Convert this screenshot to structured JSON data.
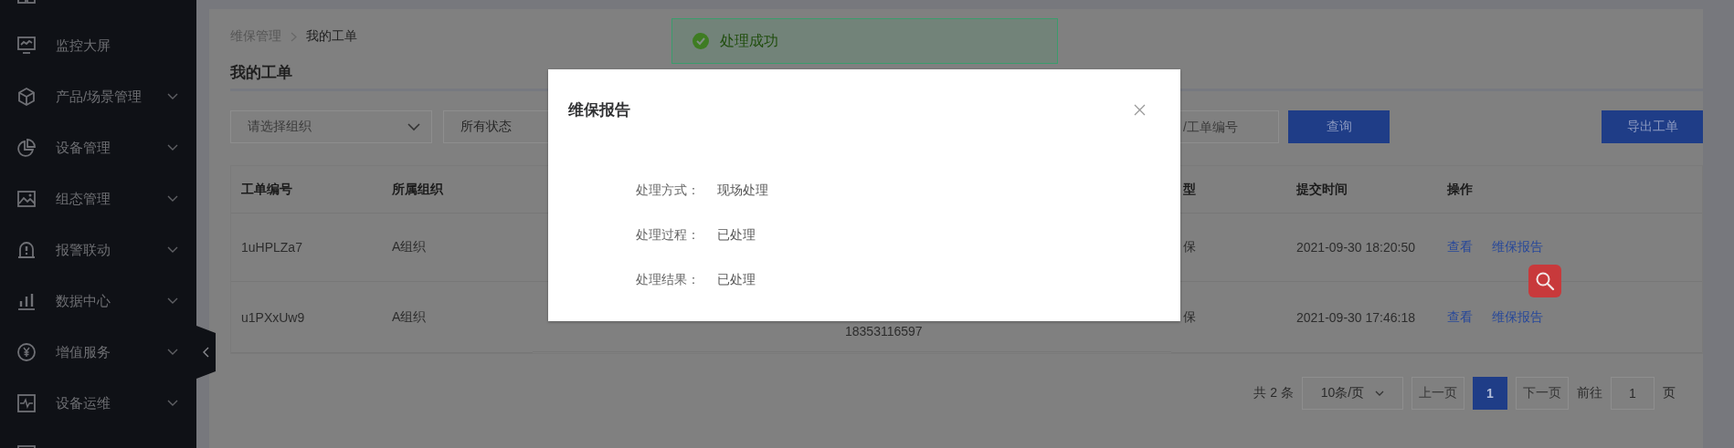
{
  "sidebar": {
    "items": [
      {
        "label": "监控大屏",
        "has_submenu": false
      },
      {
        "label": "产品/场景管理",
        "has_submenu": true
      },
      {
        "label": "设备管理",
        "has_submenu": true
      },
      {
        "label": "组态管理",
        "has_submenu": true
      },
      {
        "label": "报警联动",
        "has_submenu": true
      },
      {
        "label": "数据中心",
        "has_submenu": true
      },
      {
        "label": "增值服务",
        "has_submenu": true
      },
      {
        "label": "设备运维",
        "has_submenu": true
      }
    ]
  },
  "breadcrumb": [
    "维保管理",
    "我的工单"
  ],
  "page_title": "我的工单",
  "filters": {
    "organization": {
      "placeholder": "请选择组织"
    },
    "status": {
      "value": "所有状态"
    },
    "search": {
      "placeholder": "/工单编号"
    },
    "query_button": "查询",
    "export_button": "导出工单"
  },
  "table": {
    "columns": [
      "工单编号",
      "所属组织",
      "型",
      "提交时间",
      "操作"
    ],
    "rows": [
      {
        "work_order_no": "1uHPLZa7",
        "organization": "A组织",
        "column_5": "保",
        "submitted_at": "2021-09-30 18:20:50",
        "actions": [
          "查看",
          "维保报告"
        ]
      },
      {
        "work_order_no": "u1PXxUw9",
        "organization": "A组织",
        "phone": "18353116597",
        "column_5": "保",
        "submitted_at": "2021-09-30 17:46:18",
        "actions": [
          "查看",
          "维保报告"
        ]
      }
    ]
  },
  "pagination": {
    "total": "共 2 条",
    "page_size": "10条/页",
    "prev": "上一页",
    "pages": [
      {
        "label": "1",
        "selected": true
      }
    ],
    "next": "下一页",
    "goto_label": "前往",
    "goto_value": "1",
    "goto_suffix": "页"
  },
  "toast": {
    "message": "处理成功"
  },
  "modal": {
    "title": "维保报告",
    "fields": [
      {
        "label": "处理方式：",
        "value": "现场处理"
      },
      {
        "label": "处理过程：",
        "value": "已处理"
      },
      {
        "label": "处理结果：",
        "value": "已处理"
      }
    ]
  }
}
